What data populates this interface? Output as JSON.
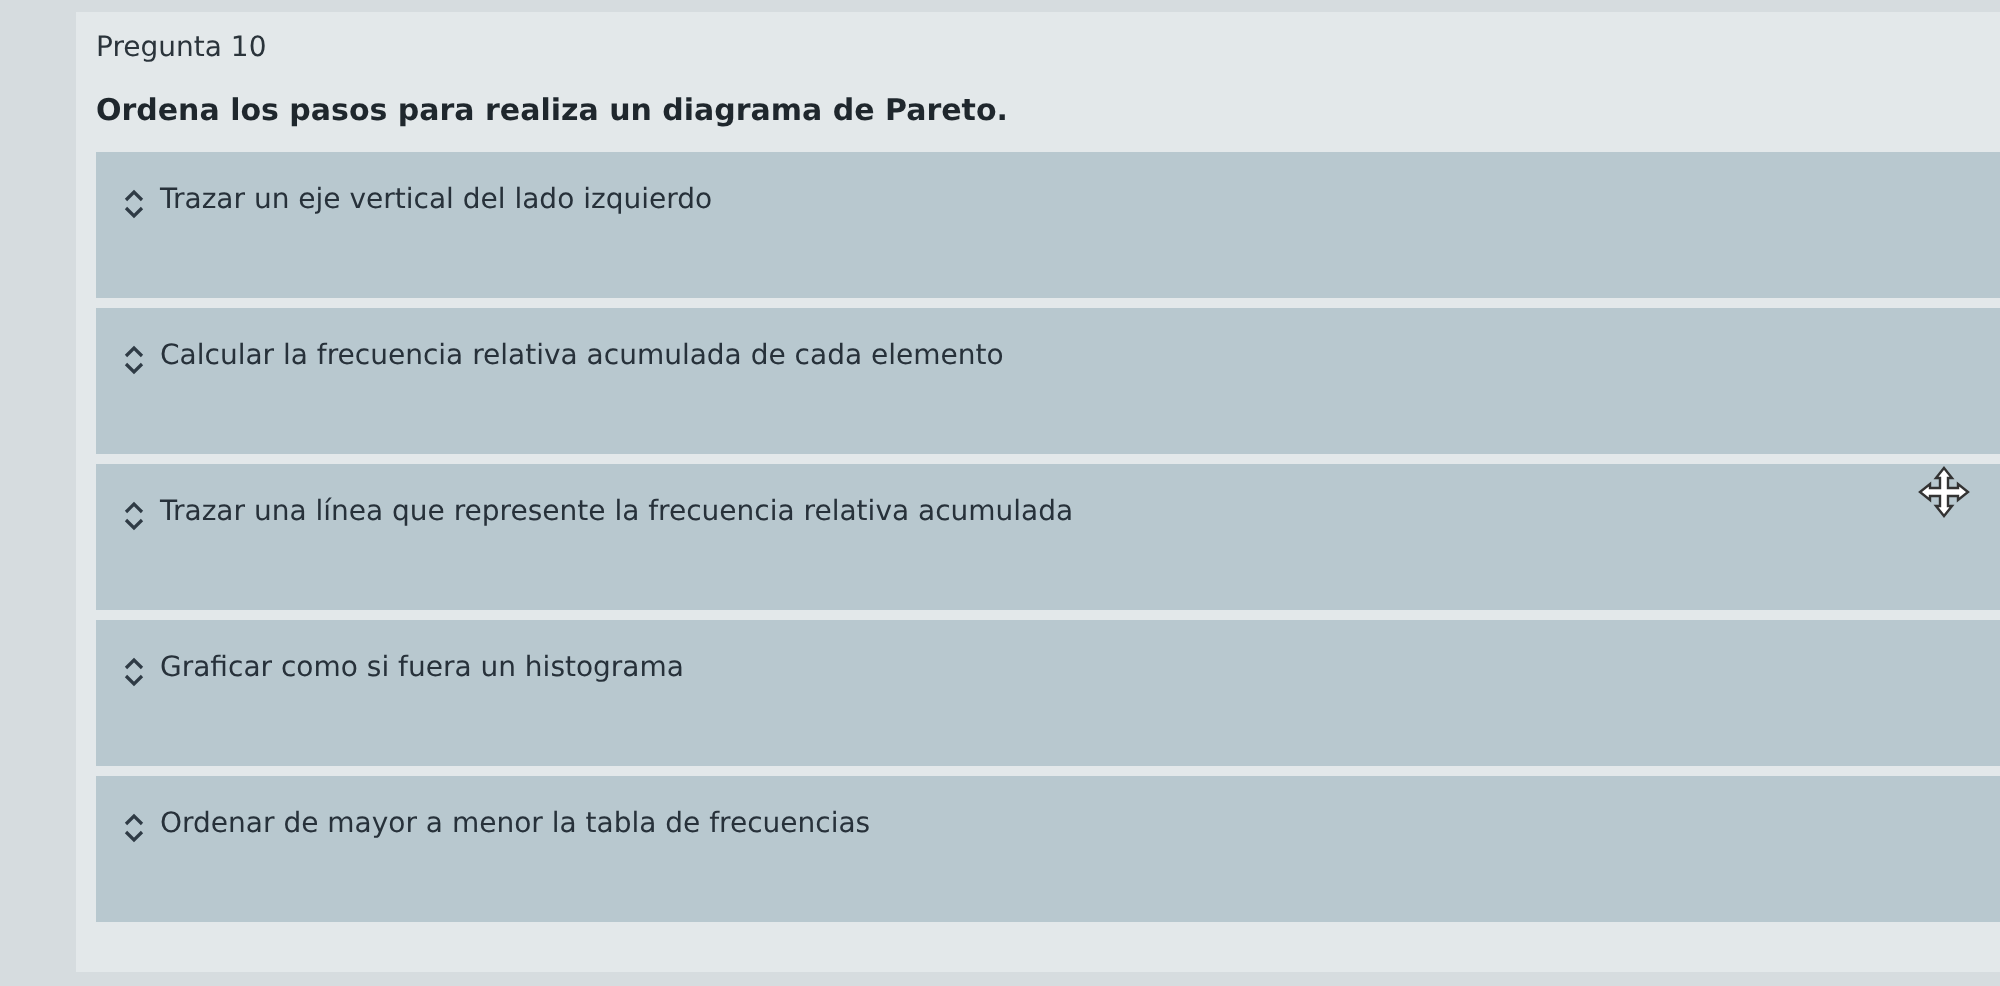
{
  "question": {
    "number": "Pregunta 10",
    "prompt": "Ordena los pasos para realiza un diagrama de Pareto."
  },
  "steps": [
    {
      "text": "Trazar un eje vertical del lado izquierdo"
    },
    {
      "text": "Calcular la frecuencia relativa acumulada de cada elemento"
    },
    {
      "text": "Trazar una línea que represente la frecuencia relativa acumulada"
    },
    {
      "text": "Graficar como si fuera un histograma"
    },
    {
      "text": "Ordenar de mayor a menor la tabla de frecuencias"
    }
  ]
}
